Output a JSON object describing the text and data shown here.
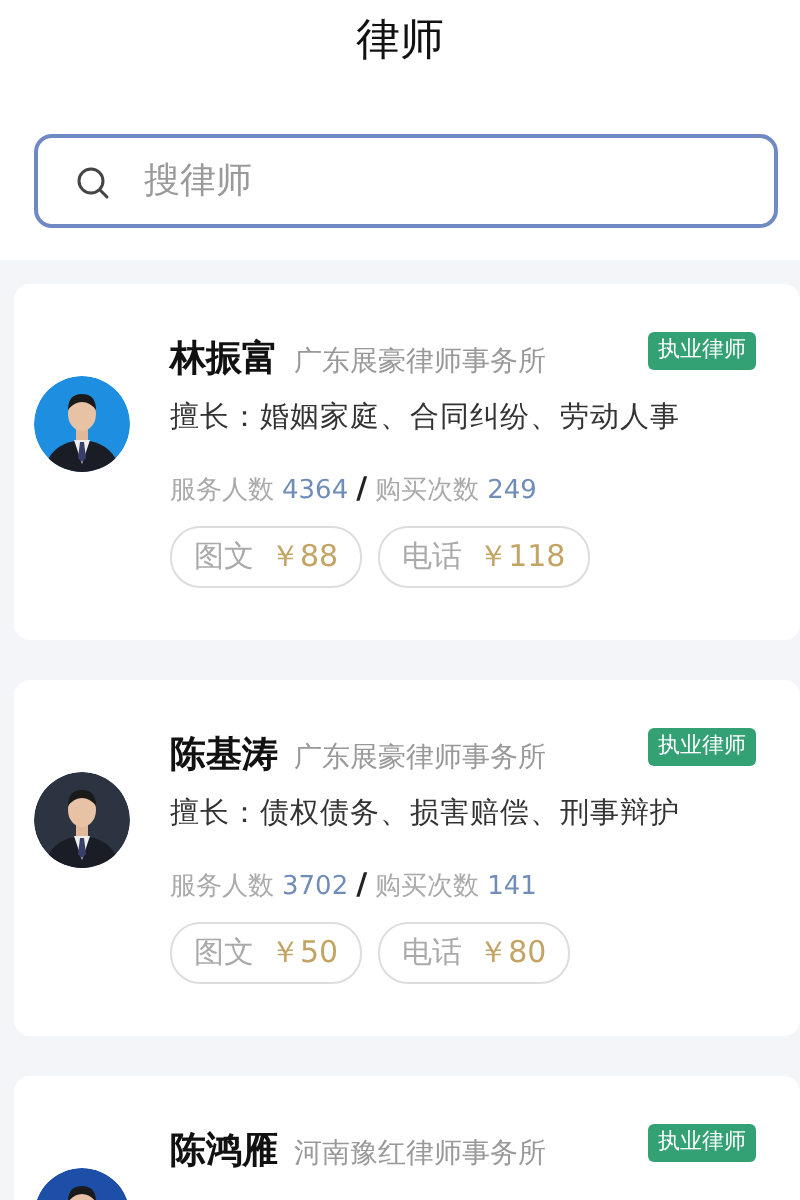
{
  "title": "律师",
  "search": {
    "placeholder": "搜律师"
  },
  "lawyers": [
    {
      "name": "林振富",
      "firm": "广东展豪律师事务所",
      "badge": "执业律师",
      "avatar": {
        "kind": "picture"
      },
      "specialty": "擅长：婚姻家庭、合同纠纷、劳动人事",
      "stats": {
        "served_label": "服务人数",
        "served": "4364",
        "separator": "/",
        "bought_label": "购买次数",
        "bought": "249"
      },
      "services": [
        {
          "label": "图文",
          "price": "￥88"
        },
        {
          "label": "电话",
          "price": "￥118"
        }
      ]
    },
    {
      "name": "陈基涛",
      "firm": "广东展豪律师事务所",
      "badge": "执业律师",
      "avatar": {
        "kind": "picture"
      },
      "specialty": "擅长：债权债务、损害赔偿、刑事辩护",
      "stats": {
        "served_label": "服务人数",
        "served": "3702",
        "separator": "/",
        "bought_label": "购买次数",
        "bought": "141"
      },
      "services": [
        {
          "label": "图文",
          "price": "￥50"
        },
        {
          "label": "电话",
          "price": "￥80"
        }
      ]
    },
    {
      "name": "陈鸿雁",
      "firm": "河南豫红律师事务所",
      "badge": "执业律师",
      "avatar": {
        "kind": "picture"
      }
    }
  ]
}
